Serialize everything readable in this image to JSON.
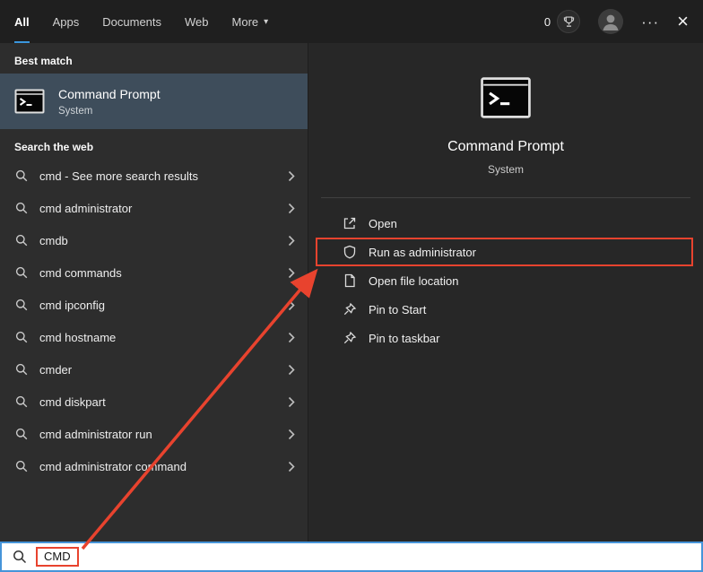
{
  "topbar": {
    "tabs": [
      {
        "label": "All",
        "active": true
      },
      {
        "label": "Apps",
        "active": false
      },
      {
        "label": "Documents",
        "active": false
      },
      {
        "label": "Web",
        "active": false
      },
      {
        "label": "More",
        "active": false
      }
    ],
    "more_arrow": "▾",
    "rewards_count": "0",
    "ellipsis_glyph": "···",
    "close_glyph": "×"
  },
  "left_panel": {
    "best_match_header": "Best match",
    "best_match": {
      "title": "Command Prompt",
      "subtitle": "System"
    },
    "search_web_header": "Search the web",
    "suggestions": [
      "cmd - See more search results",
      "cmd administrator",
      "cmdb",
      "cmd commands",
      "cmd ipconfig",
      "cmd hostname",
      "cmder",
      "cmd diskpart",
      "cmd administrator run",
      "cmd administrator command"
    ]
  },
  "right_panel": {
    "title": "Command Prompt",
    "subtitle": "System",
    "actions": [
      {
        "label": "Open",
        "icon": "open-icon",
        "highlighted": false
      },
      {
        "label": "Run as administrator",
        "icon": "shield-icon",
        "highlighted": true
      },
      {
        "label": "Open file location",
        "icon": "file-location-icon",
        "highlighted": false
      },
      {
        "label": "Pin to Start",
        "icon": "pin-icon",
        "highlighted": false
      },
      {
        "label": "Pin to taskbar",
        "icon": "pin-icon",
        "highlighted": false
      }
    ]
  },
  "search_bar": {
    "value": "CMD"
  },
  "colors": {
    "accent": "#3a96dd",
    "annotation": "#e8432e",
    "highlight": "#3e4d5b",
    "search_border": "#4694d9",
    "topbar_bg": "#1f1f1f",
    "left_bg": "#2d2d2d",
    "right_bg": "#272727"
  }
}
